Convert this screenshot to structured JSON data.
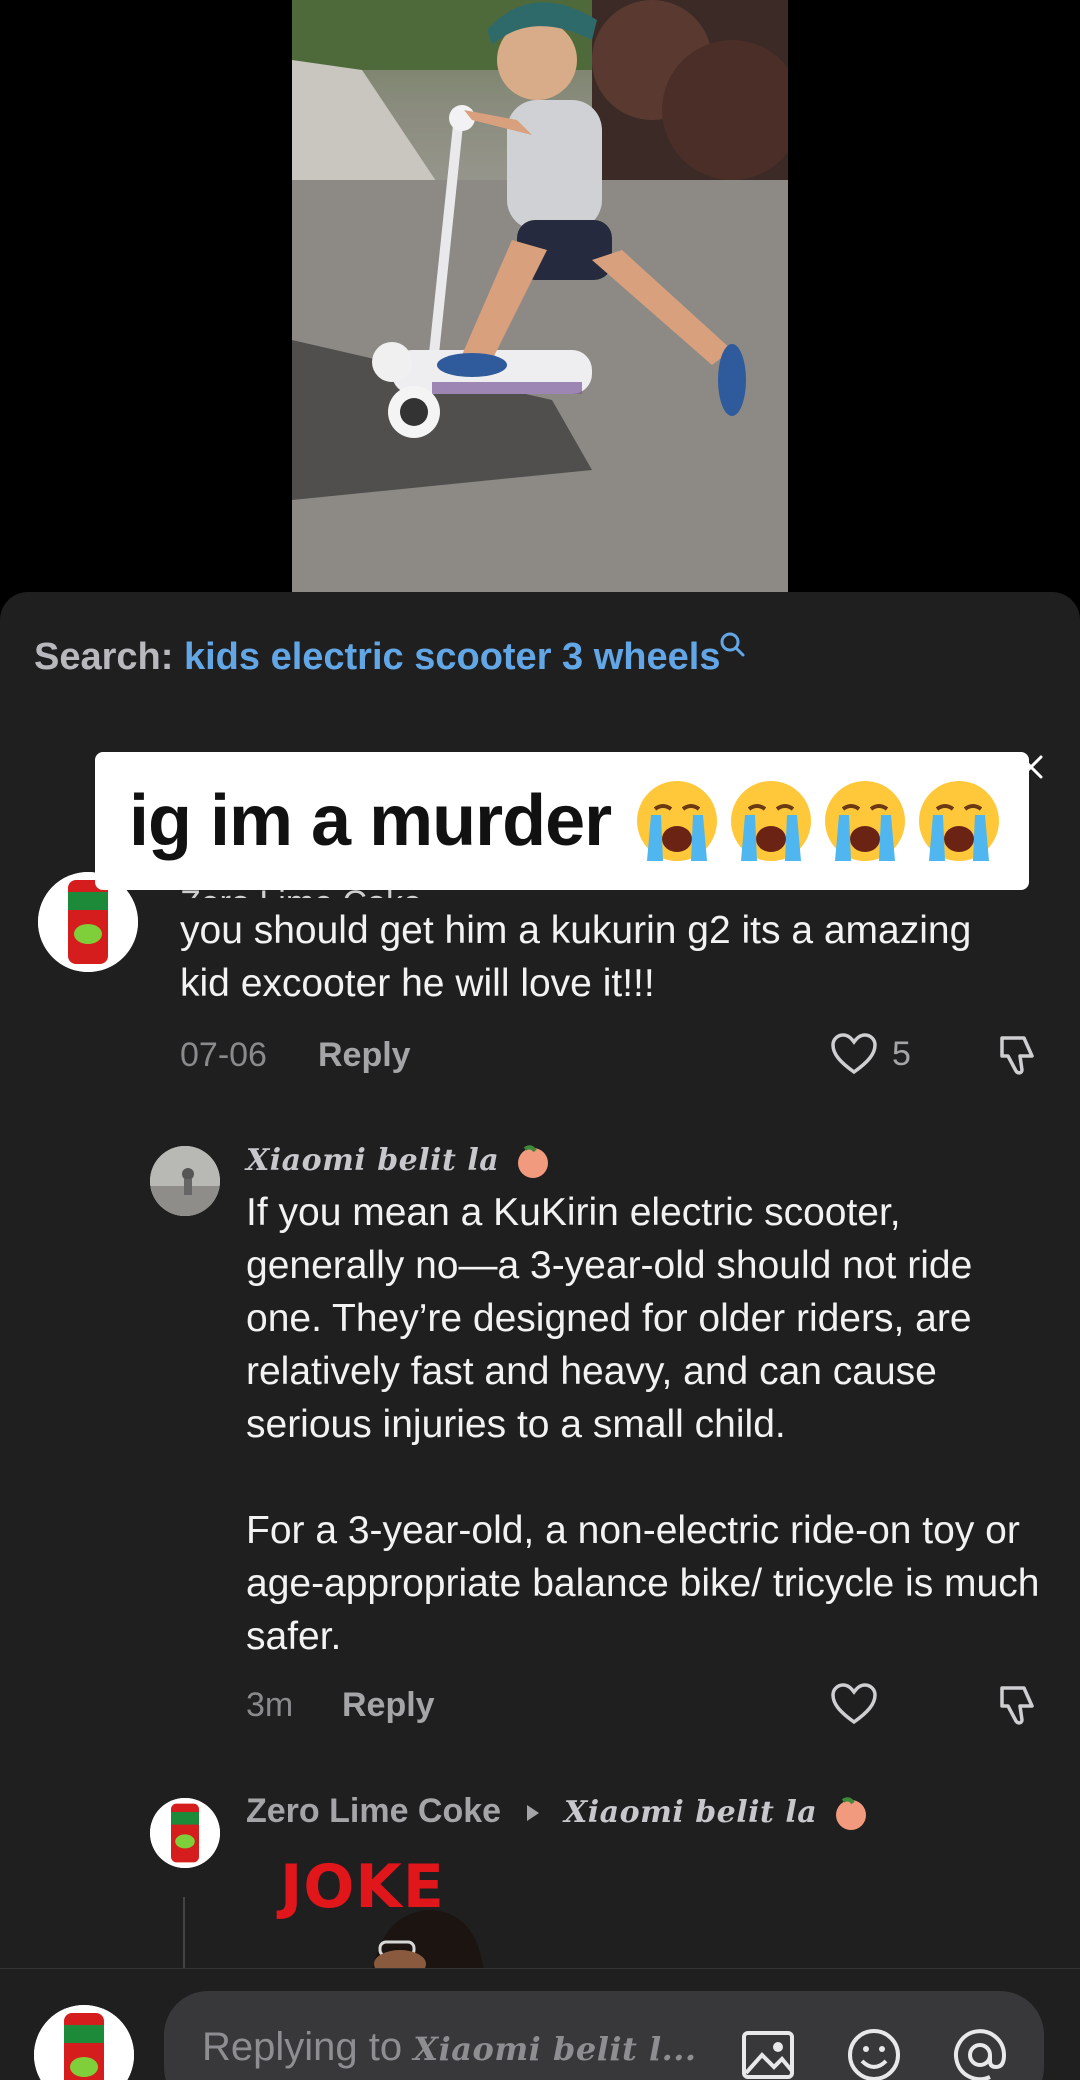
{
  "search": {
    "label": "Search:",
    "query": "kids electric scooter 3 wheels"
  },
  "sticker": {
    "text": "ig im a murder",
    "emoji": "crying-face-emoji",
    "emoji_count": 4
  },
  "comments": [
    {
      "username_partial": "Zero Lime Coke",
      "text": "you should get him a kukurin g2 its a amazing kid excooter he will love it!!!",
      "date": "07-06",
      "reply_label": "Reply",
      "likes": "5"
    },
    {
      "username": "Xiaomi belit la",
      "text_1": "If you mean a KuKirin electric scooter, generally no—a 3-year-old should not ride one. They’re designed for older riders, are relatively fast and heavy, and can cause serious injuries to a small child.",
      "text_2": "For a 3-year-old, a non-electric ride-on toy or age-appropriate balance bike/ tricycle is much safer.",
      "date": "3m",
      "reply_label": "Reply"
    },
    {
      "username": "Zero Lime Coke",
      "reply_to": "Xiaomi belit la",
      "sticker_text": "JOKE"
    }
  ],
  "bottom": {
    "placeholder_prefix": "Replying to",
    "placeholder_name": "Xiaomi belit l..."
  },
  "colors": {
    "sheet_bg": "#1f1f20",
    "link_blue": "#62a6e6",
    "input_bg": "#38383a"
  }
}
